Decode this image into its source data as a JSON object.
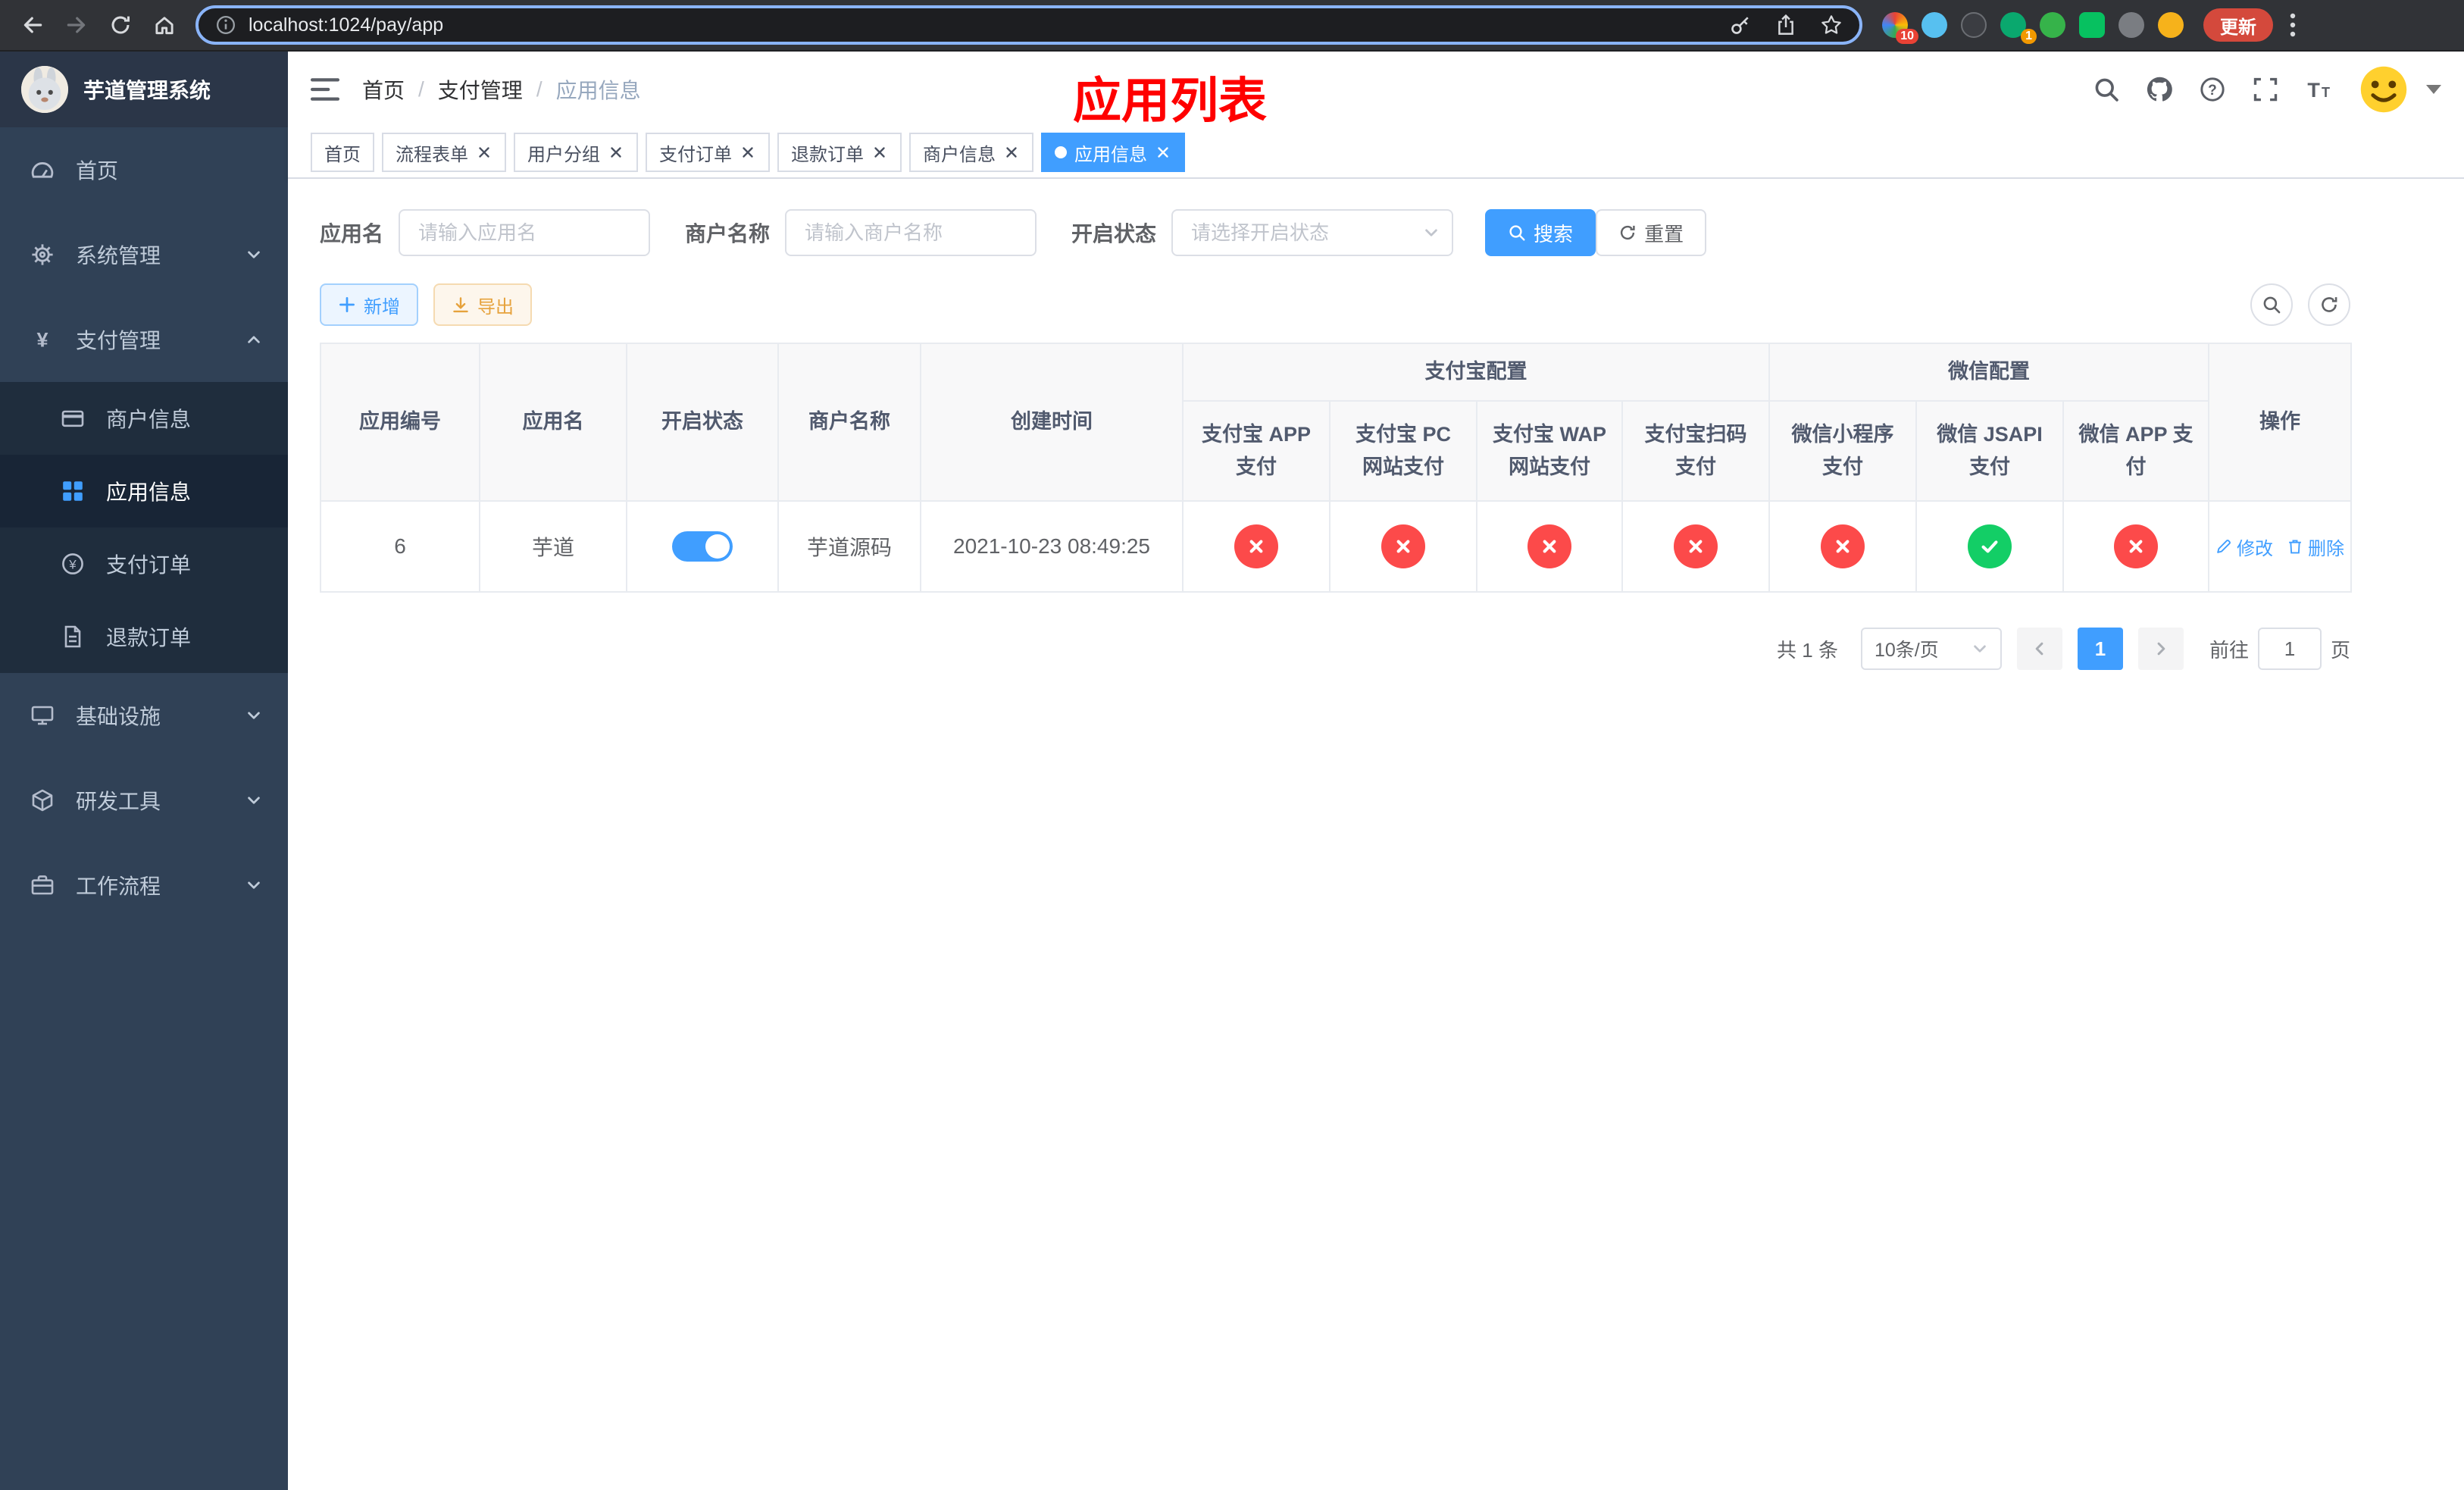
{
  "browser": {
    "url": "localhost:1024/pay/app",
    "update_label": "更新",
    "puzzle_badge": "10",
    "green_badge": "1",
    "nav_icons": [
      "back-icon",
      "forward-icon",
      "reload-icon",
      "home-icon"
    ],
    "omnibox_icons": [
      "info-icon",
      "key-icon",
      "share-icon",
      "star-icon"
    ]
  },
  "app": {
    "logo_title": "芋道管理系统"
  },
  "sidebar": {
    "items": [
      {
        "key": "home",
        "label": "首页",
        "icon": "dashboard"
      },
      {
        "key": "system",
        "label": "系统管理",
        "icon": "gear",
        "expandable": true
      },
      {
        "key": "payment",
        "label": "支付管理",
        "icon": "yen",
        "expandable": true,
        "expanded": true,
        "children": [
          {
            "key": "merchant-info",
            "label": "商户信息",
            "icon": "card"
          },
          {
            "key": "app-info",
            "label": "应用信息",
            "icon": "grid",
            "active": true
          },
          {
            "key": "pay-order",
            "label": "支付订单",
            "icon": "coin"
          },
          {
            "key": "refund-order",
            "label": "退款订单",
            "icon": "doc"
          }
        ]
      },
      {
        "key": "infrastructure",
        "label": "基础设施",
        "icon": "monitor",
        "expandable": true
      },
      {
        "key": "dev-tools",
        "label": "研发工具",
        "icon": "cube",
        "expandable": true
      },
      {
        "key": "workflow",
        "label": "工作流程",
        "icon": "briefcase",
        "expandable": true
      }
    ]
  },
  "navbar": {
    "breadcrumb": [
      "首页",
      "支付管理",
      "应用信息"
    ],
    "page_title": "应用列表",
    "right_icons": [
      "search-icon",
      "github-icon",
      "help-icon",
      "fullscreen-icon",
      "font-size-icon",
      "avatar"
    ]
  },
  "tabs": [
    {
      "label": "首页",
      "closable": false,
      "active": false
    },
    {
      "label": "流程表单",
      "closable": true,
      "active": false
    },
    {
      "label": "用户分组",
      "closable": true,
      "active": false
    },
    {
      "label": "支付订单",
      "closable": true,
      "active": false
    },
    {
      "label": "退款订单",
      "closable": true,
      "active": false
    },
    {
      "label": "商户信息",
      "closable": true,
      "active": false
    },
    {
      "label": "应用信息",
      "closable": true,
      "active": true
    }
  ],
  "filters": {
    "app_name_label": "应用名",
    "app_name_placeholder": "请输入应用名",
    "merchant_label": "商户名称",
    "merchant_placeholder": "请输入商户名称",
    "status_label": "开启状态",
    "status_placeholder": "请选择开启状态",
    "search_button": "搜索",
    "reset_button": "重置"
  },
  "toolbar": {
    "add_label": "新增",
    "export_label": "导出"
  },
  "table": {
    "simple_columns_left": [
      "应用编号",
      "应用名",
      "开启状态",
      "商户名称",
      "创建时间"
    ],
    "groups": [
      {
        "label": "支付宝配置",
        "columns": [
          "支付宝 APP 支付",
          "支付宝 PC 网站支付",
          "支付宝 WAP 网站支付",
          "支付宝扫码支付"
        ]
      },
      {
        "label": "微信配置",
        "columns": [
          "微信小程序支付",
          "微信 JSAPI 支付",
          "微信 APP 支付"
        ]
      }
    ],
    "action_column": "操作",
    "rows": [
      {
        "app_id": "6",
        "app_name": "芋道",
        "enabled": true,
        "merchant_name": "芋道源码",
        "create_time": "2021-10-23 08:49:25",
        "pay_configs": [
          false,
          false,
          false,
          false,
          false,
          true,
          false
        ],
        "actions": [
          {
            "name": "edit",
            "label": "修改",
            "icon": "edit"
          },
          {
            "name": "delete",
            "label": "删除",
            "icon": "trash"
          }
        ]
      }
    ]
  },
  "pagination": {
    "total": "共 1 条",
    "page_size": "10条/页",
    "current_page": "1",
    "goto_prefix": "前往",
    "goto_value": "1",
    "goto_suffix": "页"
  },
  "colors": {
    "primary": "#409eff",
    "success": "#13ce66",
    "danger": "#fc4a4a",
    "warning": "#e6a23c",
    "title_red": "#ff0000",
    "sidebar_bg": "#304156",
    "submenu_bg": "#1f2d3d"
  }
}
